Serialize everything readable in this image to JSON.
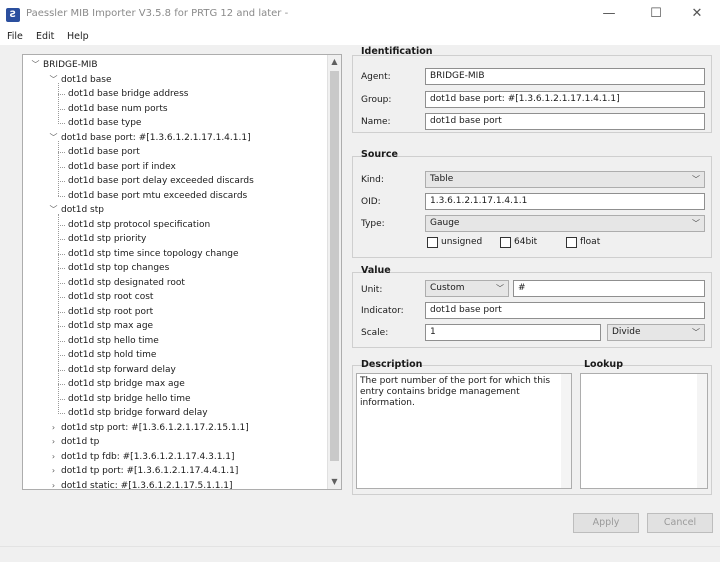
{
  "window": {
    "title": "Paessler MIB Importer V3.5.8 for PRTG 12 and later -",
    "icon_glyph": "Ƨ",
    "minimize": "—",
    "maximize": "☐",
    "close": "✕"
  },
  "menu": {
    "file": "File",
    "edit": "Edit",
    "help": "Help"
  },
  "tree": {
    "root": "BRIDGE-MIB",
    "groups": [
      {
        "label": "dot1d base",
        "expanded": true,
        "children": [
          "dot1d base bridge address",
          "dot1d base num ports",
          "dot1d base type"
        ]
      },
      {
        "label": "dot1d base port: #[1.3.6.1.2.1.17.1.4.1.1]",
        "expanded": true,
        "children": [
          "dot1d base port",
          "dot1d base port if index",
          "dot1d base port delay exceeded discards",
          "dot1d base port mtu exceeded discards"
        ]
      },
      {
        "label": "dot1d stp",
        "expanded": true,
        "children": [
          "dot1d stp protocol specification",
          "dot1d stp priority",
          "dot1d stp time since topology change",
          "dot1d stp top changes",
          "dot1d stp designated root",
          "dot1d stp root cost",
          "dot1d stp root port",
          "dot1d stp max age",
          "dot1d stp hello time",
          "dot1d stp hold time",
          "dot1d stp forward delay",
          "dot1d stp bridge max age",
          "dot1d stp bridge hello time",
          "dot1d stp bridge forward delay"
        ]
      },
      {
        "label": "dot1d stp port: #[1.3.6.1.2.1.17.2.15.1.1]",
        "expanded": false,
        "children": []
      },
      {
        "label": "dot1d tp",
        "expanded": false,
        "children": []
      },
      {
        "label": "dot1d tp fdb: #[1.3.6.1.2.1.17.4.3.1.1]",
        "expanded": false,
        "children": []
      },
      {
        "label": "dot1d tp port: #[1.3.6.1.2.1.17.4.4.1.1]",
        "expanded": false,
        "children": []
      },
      {
        "label": "dot1d static: #[1.3.6.1.2.1.17.5.1.1.1]",
        "expanded": false,
        "children": []
      }
    ]
  },
  "identification": {
    "title": "Identification",
    "agent_label": "Agent:",
    "agent_value": "BRIDGE-MIB",
    "group_label": "Group:",
    "group_value": "dot1d base port: #[1.3.6.1.2.1.17.1.4.1.1]",
    "name_label": "Name:",
    "name_value": "dot1d base port"
  },
  "source": {
    "title": "Source",
    "kind_label": "Kind:",
    "kind_value": "Table",
    "oid_label": "OID:",
    "oid_value": "1.3.6.1.2.1.17.1.4.1.1",
    "type_label": "Type:",
    "type_value": "Gauge",
    "unsigned_label": "unsigned",
    "bit64_label": "64bit",
    "float_label": "float"
  },
  "value": {
    "title": "Value",
    "unit_label": "Unit:",
    "unit_value": "Custom",
    "unit_custom": "#",
    "indicator_label": "Indicator:",
    "indicator_value": "dot1d base port",
    "scale_label": "Scale:",
    "scale_value": "1",
    "scale_op": "Divide"
  },
  "description": {
    "title": "Description",
    "text": "The port number of the port for which this entry contains bridge management information."
  },
  "lookup": {
    "title": "Lookup"
  },
  "buttons": {
    "apply": "Apply",
    "cancel": "Cancel"
  }
}
